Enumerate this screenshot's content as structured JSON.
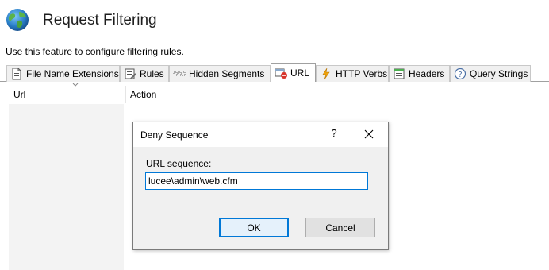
{
  "header": {
    "title": "Request Filtering",
    "description": "Use this feature to configure filtering rules."
  },
  "tabs": [
    {
      "label": "File Name Extensions",
      "icon": "file-extension-icon",
      "active": false
    },
    {
      "label": "Rules",
      "icon": "rules-icon",
      "active": false
    },
    {
      "label": "Hidden Segments",
      "icon": "hidden-segments-icon",
      "active": false
    },
    {
      "label": "URL",
      "icon": "url-deny-icon",
      "active": true
    },
    {
      "label": "HTTP Verbs",
      "icon": "lightning-icon",
      "active": false
    },
    {
      "label": "Headers",
      "icon": "headers-icon",
      "active": false
    },
    {
      "label": "Query Strings",
      "icon": "question-icon",
      "active": false
    }
  ],
  "grid": {
    "columns": [
      "Url",
      "Action"
    ]
  },
  "dialog": {
    "title": "Deny Sequence",
    "help_label": "?",
    "field_label": "URL sequence:",
    "field_value": "lucee\\admin\\web.cfm",
    "ok_label": "OK",
    "cancel_label": "Cancel"
  },
  "colors": {
    "accent": "#0078d7",
    "tab_bg": "#f0f0f0",
    "dialog_bg": "#f0f0f0"
  }
}
